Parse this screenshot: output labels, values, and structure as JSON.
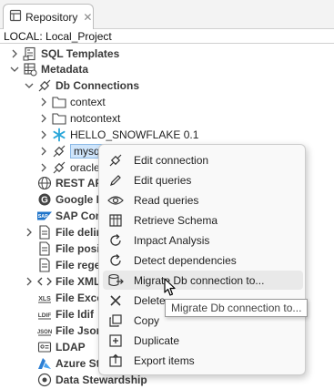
{
  "tab": {
    "label": "Repository",
    "close": "✕"
  },
  "project": {
    "label": "LOCAL: Local_Project"
  },
  "tree": {
    "sql_templates": "SQL Templates",
    "metadata": "Metadata",
    "db_connections": "Db Connections",
    "context": "context",
    "notcontext": "notcontext",
    "hello_snowflake": "HELLO_SNOWFLAKE 0.1",
    "mysql": "mysql",
    "oracle": "oracle",
    "rest_api": "REST API",
    "google": "Google E",
    "sap": "SAP Conn",
    "file_delim": "File delim",
    "file_positional": "File posit",
    "file_regex": "File rege",
    "file_xml": "File XML",
    "file_excel": "File Exce",
    "file_ldif": "File ldif",
    "file_json": "File Json",
    "ldap": "LDAP",
    "azure": "Azure St",
    "data_stewardship": "Data Stewardship"
  },
  "menu": {
    "items": [
      {
        "label": "Edit connection",
        "icon": "plug-icon"
      },
      {
        "label": "Edit queries",
        "icon": "pencil-icon"
      },
      {
        "label": "Read queries",
        "icon": "eye-icon"
      },
      {
        "label": "Retrieve Schema",
        "icon": "table-icon"
      },
      {
        "label": "Impact Analysis",
        "icon": "refresh-icon"
      },
      {
        "label": "Detect dependencies",
        "icon": "refresh-icon"
      },
      {
        "label": "Migrate Db connection to...",
        "icon": "database-arrow-icon"
      },
      {
        "label": "Delete",
        "icon": "x-icon"
      },
      {
        "label": "Copy",
        "icon": "copy-icon"
      },
      {
        "label": "Duplicate",
        "icon": "duplicate-icon"
      },
      {
        "label": "Export items",
        "icon": "export-icon"
      }
    ]
  },
  "tooltip": {
    "text": "Migrate Db connection to..."
  },
  "colors": {
    "selection": "#cfe5fb",
    "menu_bg": "#f9f9f9",
    "hover": "#e9e9e9",
    "azure": "#2d7fd3",
    "sap": "#1f74c9"
  }
}
